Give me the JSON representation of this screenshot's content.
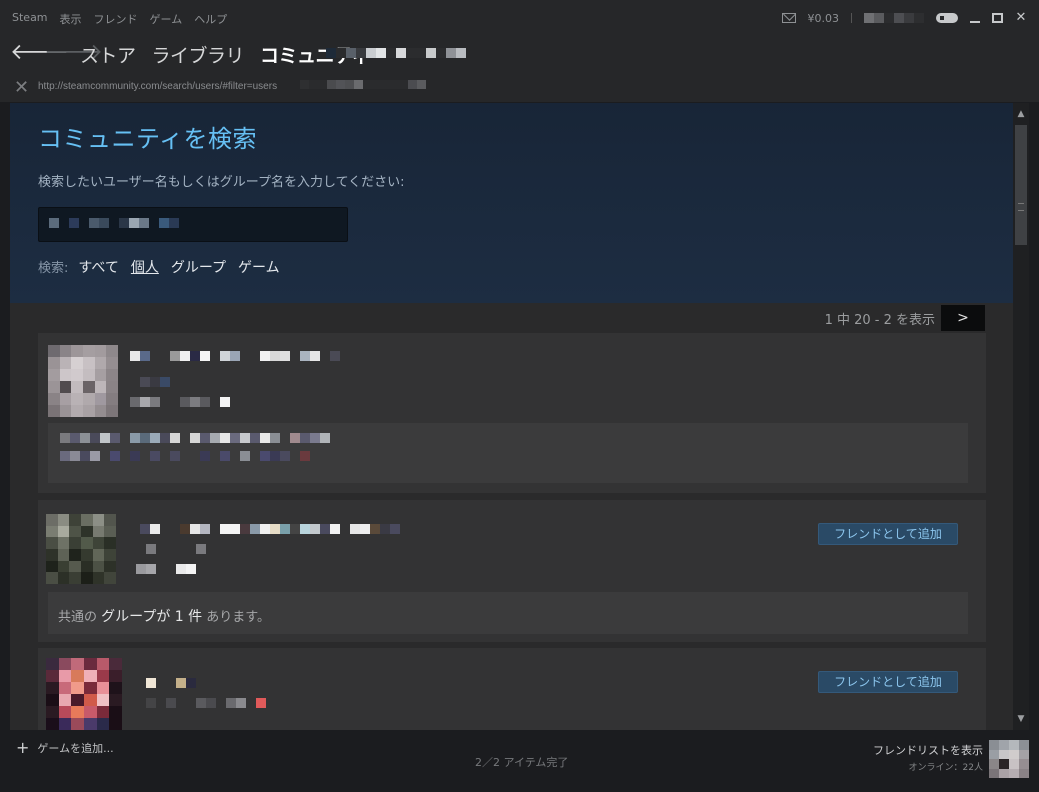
{
  "menu": [
    "Steam",
    "表示",
    "フレンド",
    "ゲーム",
    "ヘルプ"
  ],
  "titlebar": {
    "wallet": "¥0.03"
  },
  "nav": {
    "tabs": [
      "ストア",
      "ライブラリ",
      "コミュニティ"
    ]
  },
  "url": {
    "address": "http://steamcommunity.com/search/users/#filter=users"
  },
  "page": {
    "title": "コミュニティを検索",
    "description": "検索したいユーザー名もしくはグループ名を入力してください:",
    "filter_label": "検索:",
    "filters": [
      "すべて",
      "個人",
      "グループ",
      "ゲーム"
    ],
    "selected_filter": "個人",
    "paging_text": "1 中 20 - 2 を表示",
    "next_label": ">"
  },
  "results": [
    {
      "add_label": "",
      "common": ""
    },
    {
      "add_label": "フレンドとして追加",
      "common_prefix": "共通の",
      "common_count": "グループが 1 件",
      "common_suffix": "あります。"
    },
    {
      "add_label": "フレンドとして追加"
    }
  ],
  "bottom": {
    "add_game": "ゲームを追加...",
    "status": "2／2 アイテム完了",
    "friends_title": "フレンドリストを表示",
    "friends_online": "オンライン：22人"
  },
  "colors": {
    "accent": "#66c0f4",
    "button_bg": "#2a4a66",
    "button_text": "#8cc6ee"
  },
  "icons": [
    "envelope-icon",
    "gamepad-icon",
    "back-arrow-icon",
    "forward-arrow-icon",
    "close-icon",
    "plus-icon"
  ]
}
